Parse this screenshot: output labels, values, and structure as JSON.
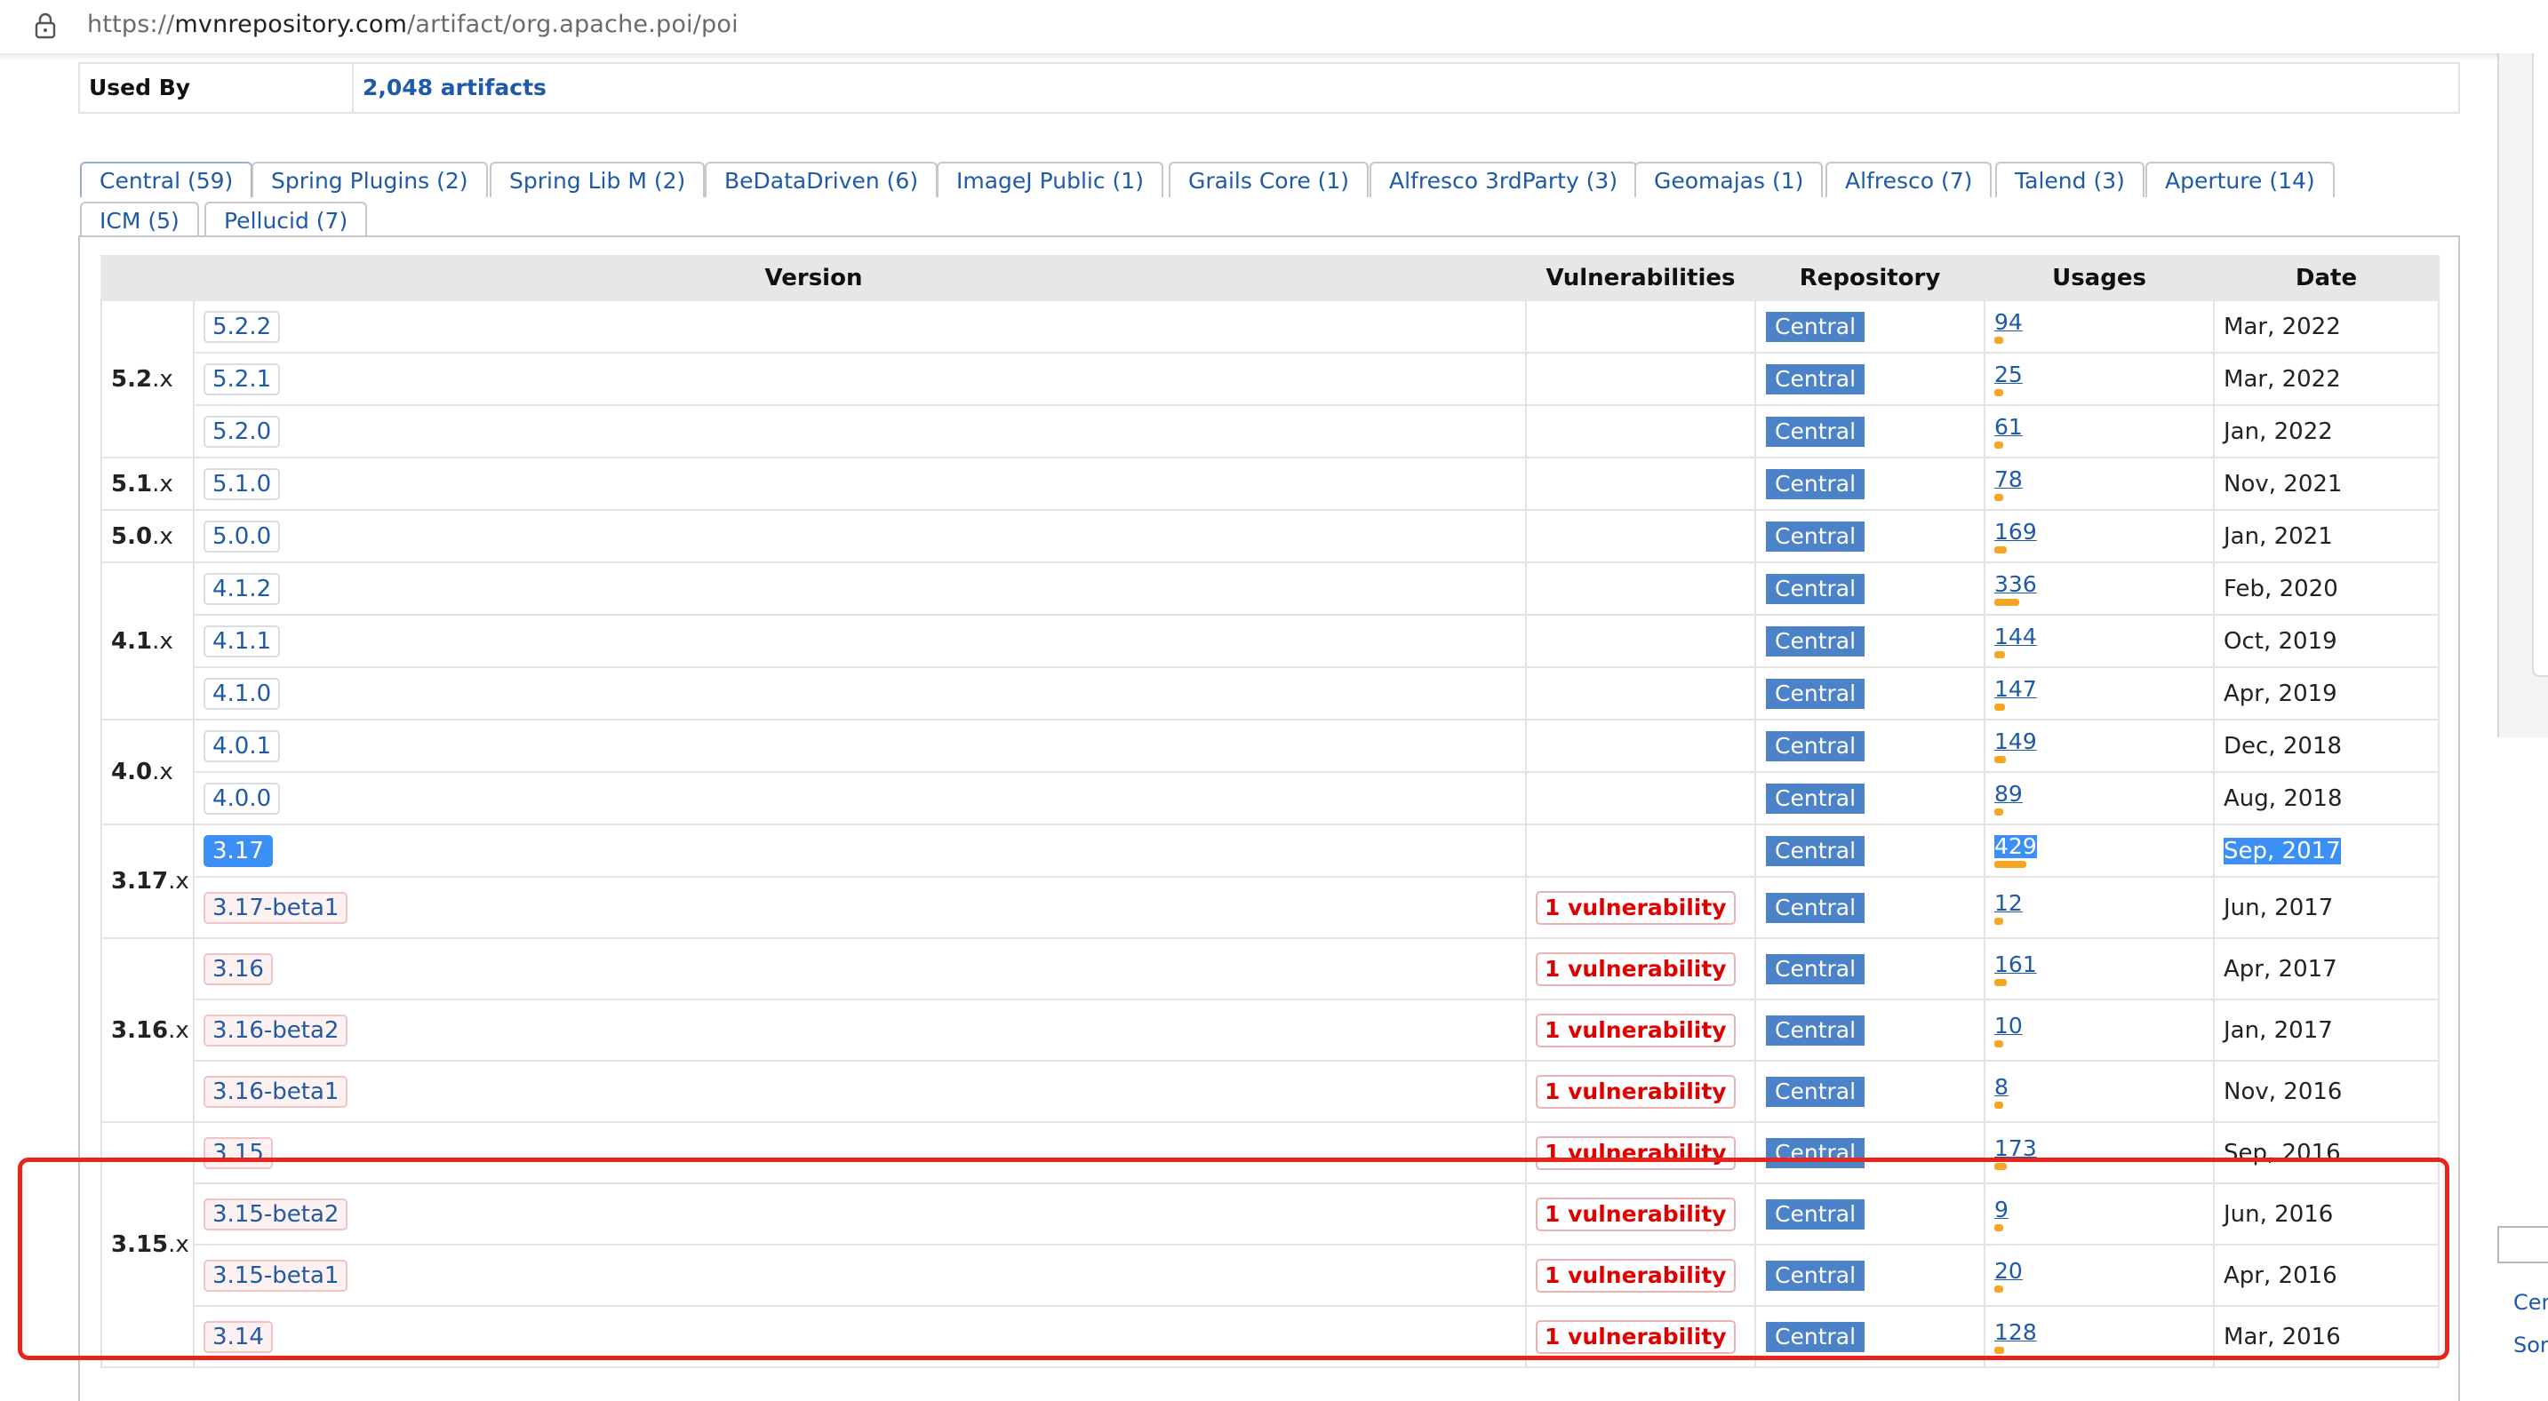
{
  "browser": {
    "url_prefix": "https://",
    "url_domain": "mvnrepository.com",
    "url_path": "/artifact/org.apache.poi/poi"
  },
  "used_by": {
    "label": "Used By",
    "value": "2,048 artifacts"
  },
  "tabs": [
    "Central (59)",
    "Spring Plugins (2)",
    "Spring Lib M (2)",
    "BeDataDriven (6)",
    "ImageJ Public (1)",
    "Grails Core (1)",
    "Alfresco 3rdParty (3)",
    "Geomajas (1)",
    "Alfresco (7)",
    "Talend (3)",
    "Aperture (14)",
    "ICM (5)",
    "Pellucid (7)"
  ],
  "table": {
    "headers": {
      "version": "Version",
      "vulnerabilities": "Vulnerabilities",
      "repository": "Repository",
      "usages": "Usages",
      "date": "Date"
    },
    "rows": [
      {
        "major": "5.2",
        "version": "5.2.2",
        "vuln": "",
        "repo": "Central",
        "usages": "94",
        "usage_level": 0.22,
        "date": "Mar, 2022"
      },
      {
        "major": "",
        "version": "5.2.1",
        "vuln": "",
        "repo": "Central",
        "usages": "25",
        "usage_level": 0.06,
        "date": "Mar, 2022"
      },
      {
        "major": "",
        "version": "5.2.0",
        "vuln": "",
        "repo": "Central",
        "usages": "61",
        "usage_level": 0.14,
        "date": "Jan, 2022"
      },
      {
        "major": "5.1",
        "version": "5.1.0",
        "vuln": "",
        "repo": "Central",
        "usages": "78",
        "usage_level": 0.18,
        "date": "Nov, 2021"
      },
      {
        "major": "5.0",
        "version": "5.0.0",
        "vuln": "",
        "repo": "Central",
        "usages": "169",
        "usage_level": 0.39,
        "date": "Jan, 2021"
      },
      {
        "major": "4.1",
        "version": "4.1.2",
        "vuln": "",
        "repo": "Central",
        "usages": "336",
        "usage_level": 0.78,
        "date": "Feb, 2020"
      },
      {
        "major": "",
        "version": "4.1.1",
        "vuln": "",
        "repo": "Central",
        "usages": "144",
        "usage_level": 0.34,
        "date": "Oct, 2019"
      },
      {
        "major": "",
        "version": "4.1.0",
        "vuln": "",
        "repo": "Central",
        "usages": "147",
        "usage_level": 0.34,
        "date": "Apr, 2019"
      },
      {
        "major": "4.0",
        "version": "4.0.1",
        "vuln": "",
        "repo": "Central",
        "usages": "149",
        "usage_level": 0.35,
        "date": "Dec, 2018"
      },
      {
        "major": "",
        "version": "4.0.0",
        "vuln": "",
        "repo": "Central",
        "usages": "89",
        "usage_level": 0.21,
        "date": "Aug, 2018"
      },
      {
        "major": "3.17",
        "version": "3.17",
        "vuln": "",
        "repo": "Central",
        "usages": "429",
        "usage_level": 1.0,
        "date": "Sep, 2017",
        "selected": true
      },
      {
        "major": "",
        "version": "3.17-beta1",
        "vuln": "1 vulnerability",
        "repo": "Central",
        "usages": "12",
        "usage_level": 0.03,
        "date": "Jun, 2017"
      },
      {
        "major": "3.16",
        "version": "3.16",
        "vuln": "1 vulnerability",
        "repo": "Central",
        "usages": "161",
        "usage_level": 0.38,
        "date": "Apr, 2017"
      },
      {
        "major": "",
        "version": "3.16-beta2",
        "vuln": "1 vulnerability",
        "repo": "Central",
        "usages": "10",
        "usage_level": 0.02,
        "date": "Jan, 2017"
      },
      {
        "major": "",
        "version": "3.16-beta1",
        "vuln": "1 vulnerability",
        "repo": "Central",
        "usages": "8",
        "usage_level": 0.02,
        "date": "Nov, 2016"
      },
      {
        "major": "3.15",
        "version": "3.15",
        "vuln": "1 vulnerability",
        "repo": "Central",
        "usages": "173",
        "usage_level": 0.4,
        "date": "Sep, 2016"
      },
      {
        "major": "",
        "version": "3.15-beta2",
        "vuln": "1 vulnerability",
        "repo": "Central",
        "usages": "9",
        "usage_level": 0.02,
        "date": "Jun, 2016"
      },
      {
        "major": "",
        "version": "3.15-beta1",
        "vuln": "1 vulnerability",
        "repo": "Central",
        "usages": "20",
        "usage_level": 0.05,
        "date": "Apr, 2016"
      },
      {
        "major": "",
        "version": "3.14",
        "vuln": "1 vulnerability",
        "repo": "Central",
        "usages": "128",
        "usage_level": 0.3,
        "date": "Mar, 2016"
      }
    ]
  },
  "side": {
    "link1": "Cer",
    "link2": "Sor"
  },
  "colors": {
    "link": "#1f5aa8",
    "repo_badge": "#4b82c8",
    "usage_bar": "#f5a623",
    "vulnerability": "#e00000",
    "selection": "#3b8ff5",
    "annotation": "#e8241c"
  }
}
